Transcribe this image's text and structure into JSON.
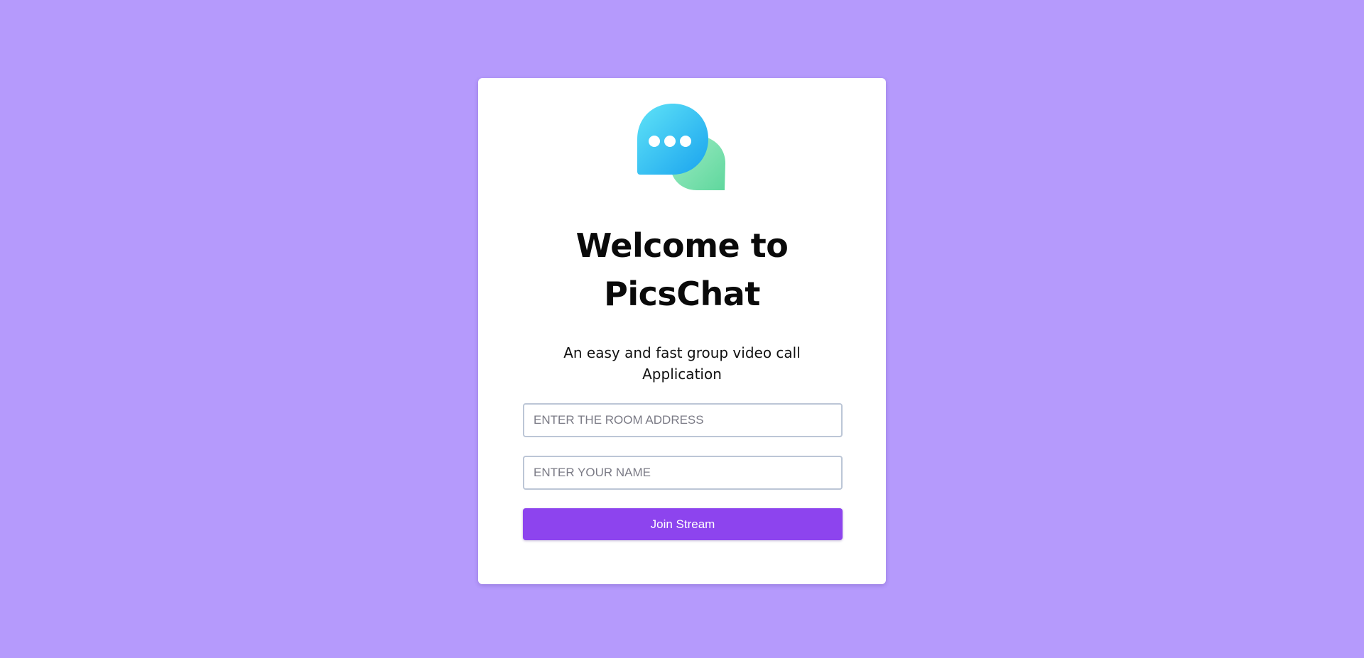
{
  "app": {
    "title_line1": "Welcome to",
    "title_line2": "PicsChat",
    "subtitle": "An easy and fast group video call Application",
    "logo_icon": "chat-bubbles-icon"
  },
  "form": {
    "room_placeholder": "ENTER THE ROOM ADDRESS",
    "name_placeholder": "ENTER YOUR NAME",
    "join_label": "Join Stream"
  },
  "colors": {
    "page_background": "#b59afc",
    "card_background": "#ffffff",
    "button_background": "#8d44ee",
    "bubble_blue": "#2fb8f2",
    "bubble_green": "#7fdfae"
  }
}
